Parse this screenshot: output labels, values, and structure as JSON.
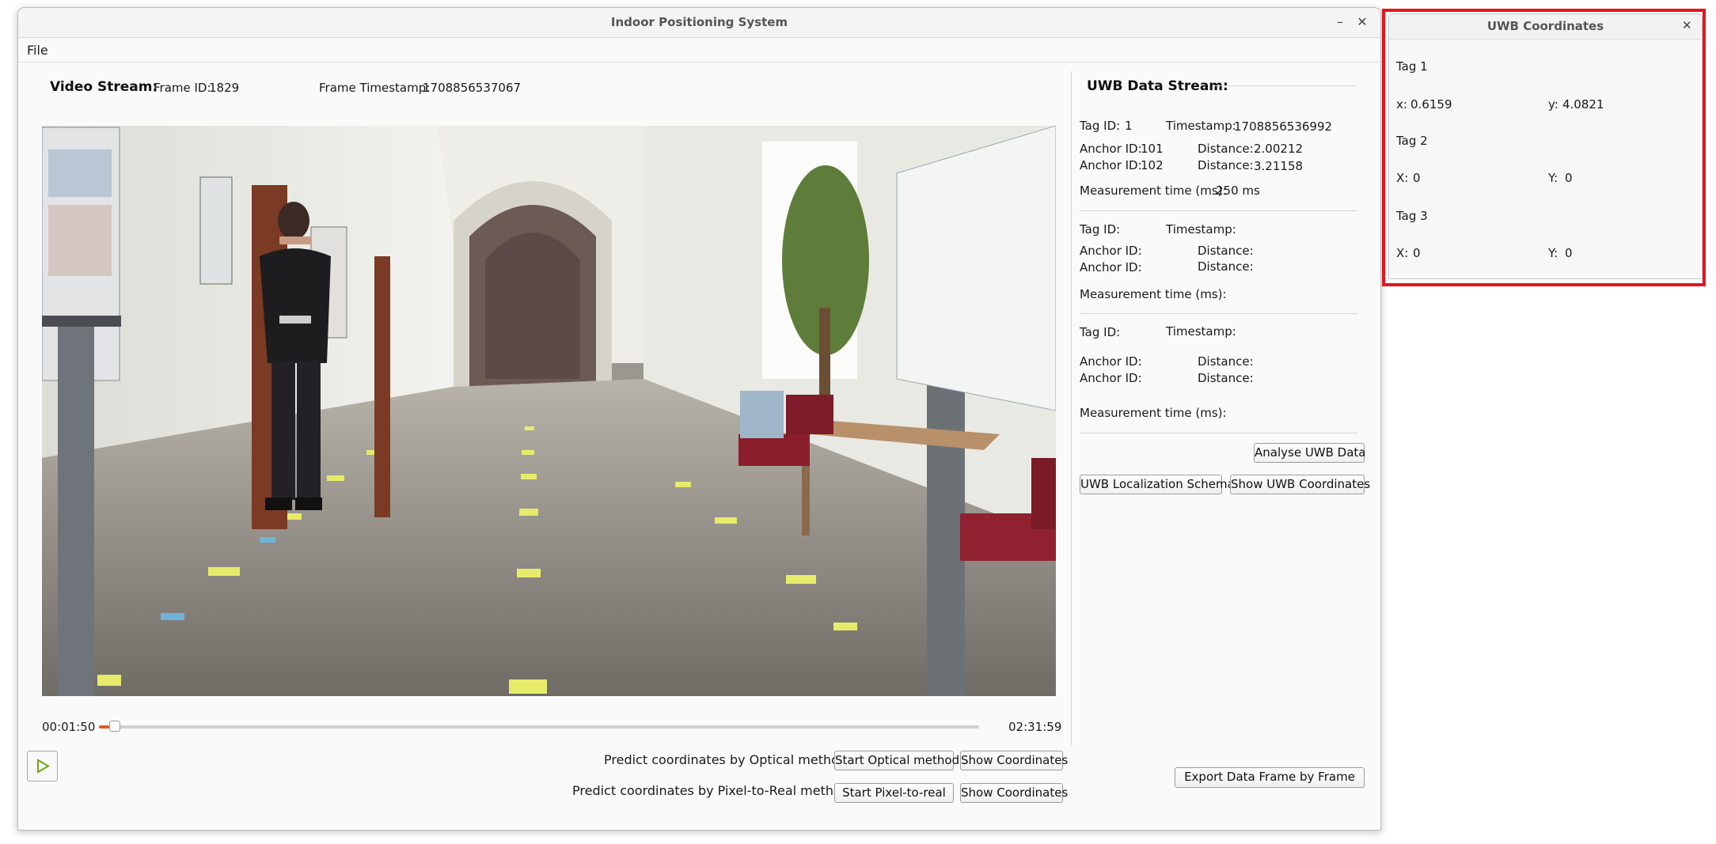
{
  "main_window": {
    "title": "Indoor Positioning System",
    "menu": [
      "File"
    ],
    "video": {
      "stream_label": "Video Stream:",
      "frame_id_label": "Frame ID:",
      "frame_id": "1829",
      "timestamp_label": "Frame Timestamp:",
      "timestamp": "1708856537067",
      "current_time": "00:01:50",
      "total_time": "02:31:59",
      "progress_fraction": 0.012
    },
    "uwb": {
      "title": "UWB Data Stream:",
      "blocks": [
        {
          "tag_id_label": "Tag ID:",
          "tag_id": "1",
          "timestamp_label": "Timestamp:",
          "timestamp": "1708856536992",
          "anchors": [
            {
              "anchor_label": "Anchor ID:",
              "anchor": "101",
              "distance_label": "Distance:",
              "distance": "2.00212"
            },
            {
              "anchor_label": "Anchor ID:",
              "anchor": "102",
              "distance_label": "Distance:",
              "distance": "3.21158"
            }
          ],
          "measure_label": "Measurement time (ms):",
          "measure": "250 ms"
        },
        {
          "tag_id_label": "Tag ID:",
          "tag_id": "",
          "timestamp_label": "Timestamp:",
          "timestamp": "",
          "anchors": [
            {
              "anchor_label": "Anchor ID:",
              "anchor": "",
              "distance_label": "Distance:",
              "distance": ""
            },
            {
              "anchor_label": "Anchor ID:",
              "anchor": "",
              "distance_label": "Distance:",
              "distance": ""
            }
          ],
          "measure_label": "Measurement time (ms):",
          "measure": ""
        },
        {
          "tag_id_label": "Tag ID:",
          "tag_id": "",
          "timestamp_label": "Timestamp:",
          "timestamp": "",
          "anchors": [
            {
              "anchor_label": "Anchor ID:",
              "anchor": "",
              "distance_label": "Distance:",
              "distance": ""
            },
            {
              "anchor_label": "Anchor ID:",
              "anchor": "",
              "distance_label": "Distance:",
              "distance": ""
            }
          ],
          "measure_label": "Measurement time (ms):",
          "measure": ""
        }
      ],
      "analyse_button": "Analyse UWB Data",
      "schema_button": "UWB Localization Schema",
      "show_coords_button": "Show UWB Coordinates"
    },
    "predict": {
      "optical_label": "Predict coordinates by Optical method:",
      "optical_start": "Start Optical method",
      "optical_show": "Show Coordinates",
      "p2r_label": "Predict coordinates by Pixel-to-Real method:",
      "p2r_start": "Start Pixel-to-real",
      "p2r_show": "Show Coordinates"
    },
    "export_button": "Export Data Frame by Frame",
    "play_icon": "play-icon"
  },
  "popup": {
    "title": "UWB Coordinates",
    "tags": [
      {
        "name": "Tag 1",
        "x_label": "x:",
        "x": "0.6159",
        "y_label": "y:",
        "y": "4.0821"
      },
      {
        "name": "Tag 2",
        "x_label": "X:",
        "x": "0",
        "y_label": "Y:",
        "y": "0"
      },
      {
        "name": "Tag 3",
        "x_label": "X:",
        "x": "0",
        "y_label": "Y:",
        "y": "0"
      }
    ]
  },
  "colors": {
    "accent": "#e95420",
    "highlight": "#e4151b",
    "play": "#6fa51c"
  }
}
